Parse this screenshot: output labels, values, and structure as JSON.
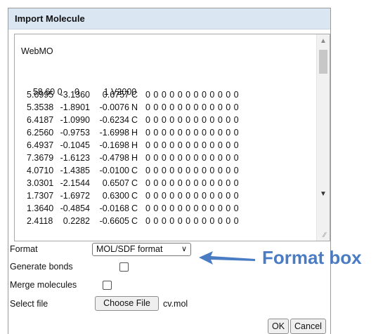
{
  "dialog": {
    "title": "Import Molecule"
  },
  "molfile": {
    "header": "WebMO",
    "counts": [
      "58",
      "60",
      "0",
      "0",
      "1",
      "V2000"
    ],
    "atoms": [
      {
        "x": "5.6995",
        "y": "-3.1360",
        "z": "0.6757",
        "el": "C"
      },
      {
        "x": "5.3538",
        "y": "-1.8901",
        "z": "-0.0076",
        "el": "N"
      },
      {
        "x": "6.4187",
        "y": "-1.0990",
        "z": "-0.6234",
        "el": "C"
      },
      {
        "x": "6.2560",
        "y": "-0.9753",
        "z": "-1.6998",
        "el": "H"
      },
      {
        "x": "6.4937",
        "y": "-0.1045",
        "z": "-0.1698",
        "el": "H"
      },
      {
        "x": "7.3679",
        "y": "-1.6123",
        "z": "-0.4798",
        "el": "H"
      },
      {
        "x": "4.0710",
        "y": "-1.4385",
        "z": "-0.0100",
        "el": "C"
      },
      {
        "x": "3.0301",
        "y": "-2.1544",
        "z": "0.6507",
        "el": "C"
      },
      {
        "x": "1.7307",
        "y": "-1.6972",
        "z": "0.6300",
        "el": "C"
      },
      {
        "x": "1.3640",
        "y": "-0.4854",
        "z": "-0.0168",
        "el": "C"
      },
      {
        "x": "2.4118",
        "y": "0.2282",
        "z": "-0.6605",
        "el": "C"
      }
    ],
    "zero_fields": "0 0 0 0 0 0 0 0 0 0 0 0"
  },
  "form": {
    "format_label": "Format",
    "format_value": "MOL/SDF format",
    "generate_bonds_label": "Generate bonds",
    "generate_bonds_checked": false,
    "merge_molecules_label": "Merge molecules",
    "merge_molecules_checked": false,
    "select_file_label": "Select file",
    "choose_file_label": "Choose File",
    "file_name": "cv.mol"
  },
  "buttons": {
    "ok": "OK",
    "cancel": "Cancel"
  },
  "annotation": {
    "text": "Format box",
    "color": "#4a7cc3"
  }
}
